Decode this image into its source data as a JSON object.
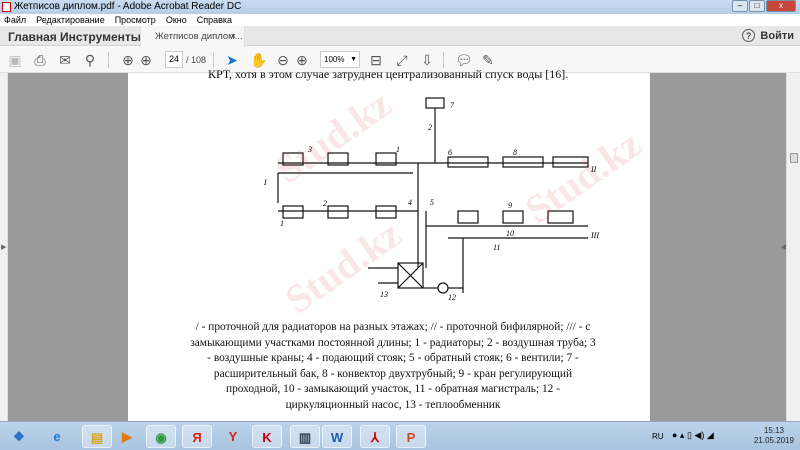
{
  "window": {
    "title": "Жетписов диплом.pdf - Adobe Acrobat Reader DC"
  },
  "menu": [
    "Файл",
    "Редактирование",
    "Просмотр",
    "Окно",
    "Справка"
  ],
  "tabs": {
    "home": "Главная",
    "tools": "Инструменты",
    "document": "Жетписов диплом...",
    "close": "×",
    "help": "?",
    "login": "Войти"
  },
  "toolbar": {
    "page_current": "24",
    "page_total": "/ 108",
    "zoom": "100%"
  },
  "document": {
    "top_text": "КРТ, хотя в этом случае затруднен централизованный спуск воды [16].",
    "caption": "/ - проточной для радиаторов на разных этажах; // - проточной бифилярной; /// - с замыкающими участками постоянной длины; 1 - радиаторы; 2 - воздушная труба; 3 - воздушные краны; 4 - подающий стояк; 5 - обратный стояк; 6 - вентили; 7 - расширительный бак, 8 - конвектор  двухтрубный;        9 - кран регулирующий   проходной, 10 - замыкающий  участок, 11 - обратная магистраль; 12 - циркуляционный насос, 13 - теплообменник",
    "diagram_labels": [
      "7",
      "2",
      "3",
      "1",
      "6",
      "8",
      "I",
      "II",
      "4",
      "5",
      "1",
      "2",
      "9",
      "10",
      "III",
      "11",
      "12",
      "13"
    ],
    "watermark": "Stud.kz"
  },
  "taskbar": {
    "lang": "RU",
    "time": "15:13",
    "date": "21.05.2019"
  }
}
